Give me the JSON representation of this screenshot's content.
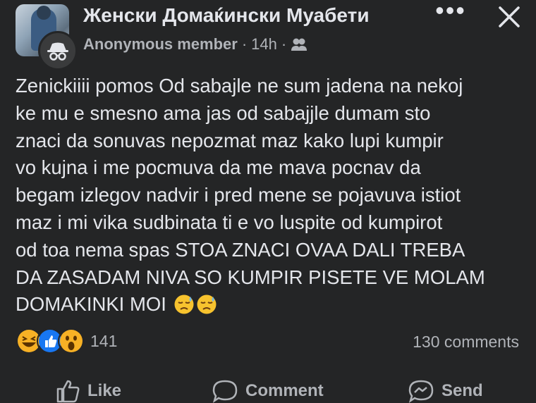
{
  "header": {
    "group_name": "Женски Домаќински Муабети",
    "author": "Anonymous member",
    "time": "14h",
    "separator": "·",
    "privacy_icon": "group-privacy-icon",
    "more_icon": "more-options-icon",
    "more_label": "•••",
    "close_icon": "close-icon"
  },
  "post": {
    "lines": [
      "Zenickiiii pomos Od sabajle ne sum jadena na nekoj",
      "ke mu e smesno  ama jas od sabajjle dumam sto",
      "znaci da sonuvas nepozmat maz kako lupi kumpir",
      "vo kujna i me pocmuva da me mava pocnav da",
      "begam izlegov nadvir i pred mene se pojavuva istiot",
      "maz i mi vika sudbinata ti e vo luspite od kumpirot",
      "od toa nema spas STOA ZNACI OVAA DALI TREBA",
      "DA ZASADAM NIVA SO KUMPIR PISETE VE MOLAM",
      "DOMAKINKI MOI"
    ],
    "trailing_emoji": [
      "downcast-face-with-sweat",
      "downcast-face-with-sweat"
    ]
  },
  "stats": {
    "reaction_icons": [
      "haha-reaction-icon",
      "like-reaction-icon",
      "wow-reaction-icon"
    ],
    "reaction_count": "141",
    "comments": "130 comments"
  },
  "actions": {
    "like": "Like",
    "comment": "Comment",
    "send": "Send"
  },
  "colors": {
    "background": "#242526",
    "text": "#e4e6eb",
    "secondary_text": "#b0b3b8",
    "like_blue": "#1877f2",
    "reaction_yellow": "#f7b125"
  }
}
